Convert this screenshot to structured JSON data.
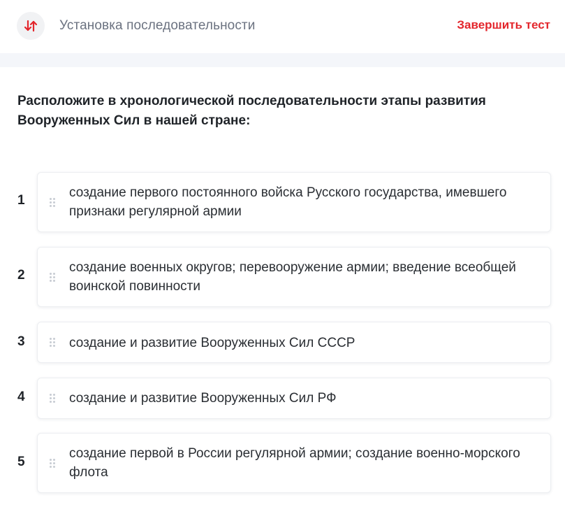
{
  "header": {
    "type_icon": "sort-arrows-icon",
    "type_label": "Установка последовательности",
    "finish_label": "Завершить тест",
    "accent_color": "#e3262c"
  },
  "question": {
    "text": "Расположите в хронологической последовательности этапы развития Вооруженных Сил в нашей стране:"
  },
  "items": [
    {
      "number": "1",
      "text": "создание первого постоянного войска Русского государства, имевшего признаки регулярной армии"
    },
    {
      "number": "2",
      "text": "создание военных округов; перевооружение армии; введение всеобщей воинской повинности"
    },
    {
      "number": "3",
      "text": "создание и развитие Вооруженных Сил СССР"
    },
    {
      "number": "4",
      "text": "создание и развитие Вооруженных Сил РФ"
    },
    {
      "number": "5",
      "text": "создание первой в России регулярной армии; создание военно-морского флота"
    }
  ]
}
